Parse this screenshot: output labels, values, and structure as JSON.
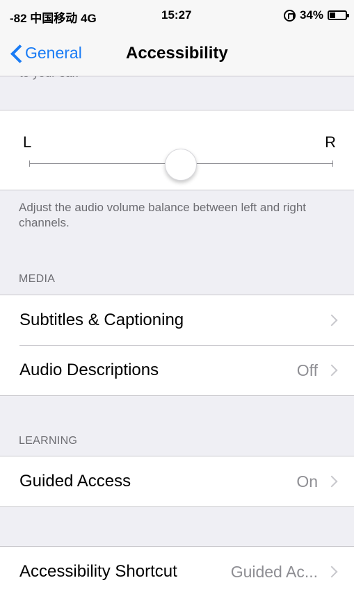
{
  "status": {
    "carrier": "-82 中国移动 4G",
    "time": "15:27",
    "battery": "34%",
    "battery_level": 0.34
  },
  "nav": {
    "back_label": "General",
    "title": "Accessibility"
  },
  "top_footer_fragment": "to your ear.",
  "balance": {
    "left_label": "L",
    "right_label": "R",
    "position": 0.5,
    "footer": "Adjust the audio volume balance between left and right channels."
  },
  "media": {
    "header": "MEDIA",
    "rows": [
      {
        "label": "Subtitles & Captioning",
        "value": ""
      },
      {
        "label": "Audio Descriptions",
        "value": "Off"
      }
    ]
  },
  "learning": {
    "header": "LEARNING",
    "rows": [
      {
        "label": "Guided Access",
        "value": "On"
      }
    ]
  },
  "shortcut": {
    "label": "Accessibility Shortcut",
    "value": "Guided Ac..."
  }
}
